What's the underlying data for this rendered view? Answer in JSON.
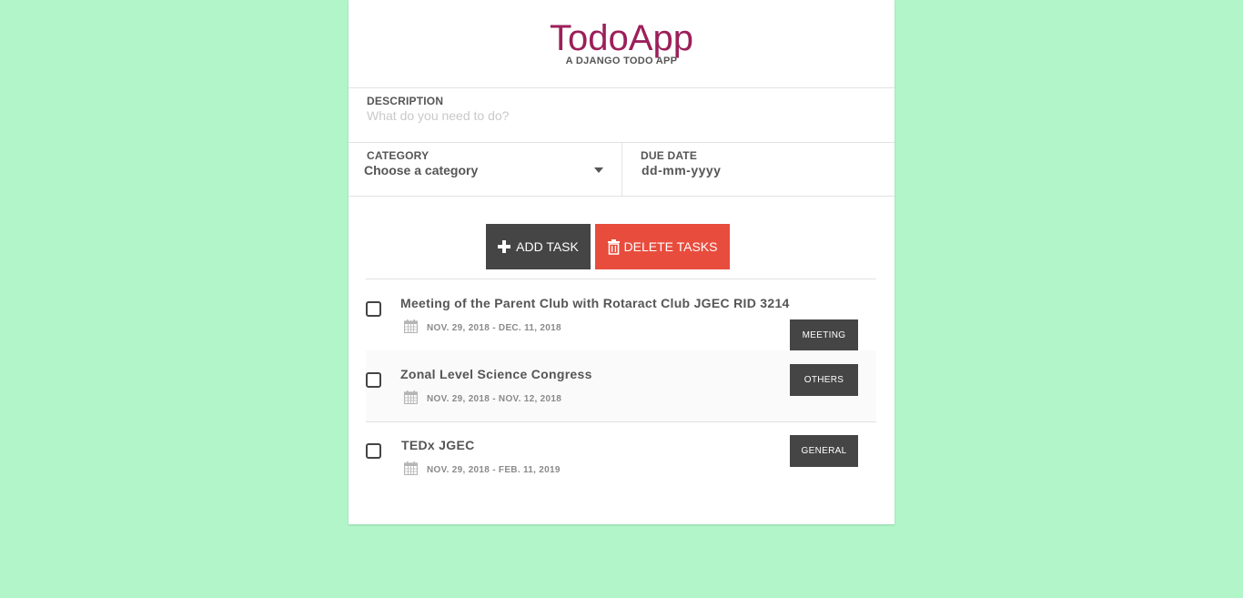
{
  "app": {
    "title": "TodoApp",
    "subtitle": "A DJANGO TODO APP"
  },
  "form": {
    "description_label": "DESCRIPTION",
    "description_placeholder": "What do you need to do?",
    "description_value": "",
    "category_label": "CATEGORY",
    "category_value": "Choose a category",
    "due_date_label": "DUE DATE",
    "due_date_value": "dd-mm-yyyy"
  },
  "actions": {
    "add_label": "ADD TASK",
    "delete_label": "DELETE TASKS"
  },
  "tasks": [
    {
      "title": "Meeting of the Parent Club with Rotaract Club JGEC RID 3214",
      "dates": "NOV. 29, 2018 - DEC. 11, 2018",
      "category": "MEETING",
      "checked": false
    },
    {
      "title": "Zonal Level Science Congress",
      "dates": "NOV. 29, 2018 - NOV. 12, 2018",
      "category": "OTHERS",
      "checked": false
    },
    {
      "title": "TEDx JGEC",
      "dates": "NOV. 29, 2018 - FEB. 11, 2019",
      "category": "GENERAL",
      "checked": false
    }
  ],
  "colors": {
    "background": "#b1f5c9",
    "title": "#9c1f5a",
    "add_button": "#454545",
    "delete_button": "#e84c3d",
    "badge": "#454545"
  },
  "icons": {
    "add": "plus-icon",
    "delete": "trash-icon",
    "date": "calendar-icon",
    "category_dropdown": "caret-down-icon"
  }
}
